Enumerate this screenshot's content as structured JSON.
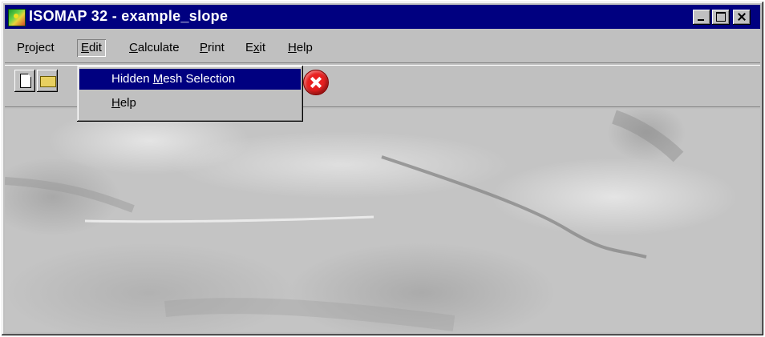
{
  "window": {
    "title": "ISOMAP 32 - example_slope"
  },
  "menubar": {
    "items": [
      {
        "pre": "P",
        "key": "r",
        "post": "oject"
      },
      {
        "pre": "",
        "key": "E",
        "post": "dit"
      },
      {
        "pre": "",
        "key": "C",
        "post": "alculate"
      },
      {
        "pre": "",
        "key": "P",
        "post": "rint"
      },
      {
        "pre": "E",
        "key": "x",
        "post": "it"
      },
      {
        "pre": "",
        "key": "H",
        "post": "elp"
      }
    ]
  },
  "edit_menu": {
    "items": [
      {
        "pre": "Hidden ",
        "key": "M",
        "post": "esh Selection",
        "highlighted": true
      },
      {
        "pre": "",
        "key": "H",
        "post": "elp",
        "highlighted": false
      }
    ]
  },
  "toolbar": {
    "buttons": [
      "new-document-icon",
      "open-folder-icon",
      "stop-icon"
    ]
  },
  "colors": {
    "titlebar": "#000080",
    "face": "#c0c0c0",
    "highlight": "#000080",
    "stop": "#e82020"
  }
}
